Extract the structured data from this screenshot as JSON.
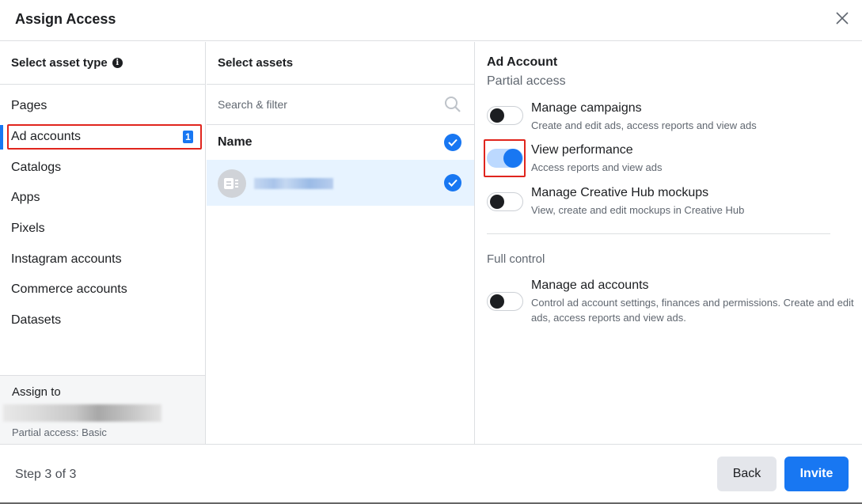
{
  "dialog": {
    "title": "Assign Access",
    "close_icon": "close-icon"
  },
  "asset_types": {
    "header": "Select asset type",
    "items": [
      {
        "label": "Pages"
      },
      {
        "label": "Ad accounts",
        "badge": "1",
        "selected": true
      },
      {
        "label": "Catalogs"
      },
      {
        "label": "Apps"
      },
      {
        "label": "Pixels"
      },
      {
        "label": "Instagram accounts"
      },
      {
        "label": "Commerce accounts"
      },
      {
        "label": "Datasets"
      }
    ],
    "assign_to_label": "Assign to",
    "assign_sub": "Partial access: Basic"
  },
  "assets": {
    "header": "Select assets",
    "search_placeholder": "Search & filter",
    "name_header": "Name"
  },
  "permissions": {
    "header": "Ad Account",
    "partial_label": "Partial access",
    "partial": [
      {
        "title": "Manage campaigns",
        "desc": "Create and edit ads, access reports and view ads",
        "on": false
      },
      {
        "title": "View performance",
        "desc": "Access reports and view ads",
        "on": true
      },
      {
        "title": "Manage Creative Hub mockups",
        "desc": "View, create and edit mockups in Creative Hub",
        "on": false
      }
    ],
    "full_label": "Full control",
    "full": [
      {
        "title": "Manage ad accounts",
        "desc": "Control ad account settings, finances and permissions. Create and edit ads, access reports and view ads.",
        "on": false
      }
    ]
  },
  "footer": {
    "step": "Step 3 of 3",
    "back_label": "Back",
    "invite_label": "Invite"
  },
  "colors": {
    "accent": "#1877f2",
    "highlight_box": "#e0251d",
    "selected_row": "#e7f3ff"
  }
}
